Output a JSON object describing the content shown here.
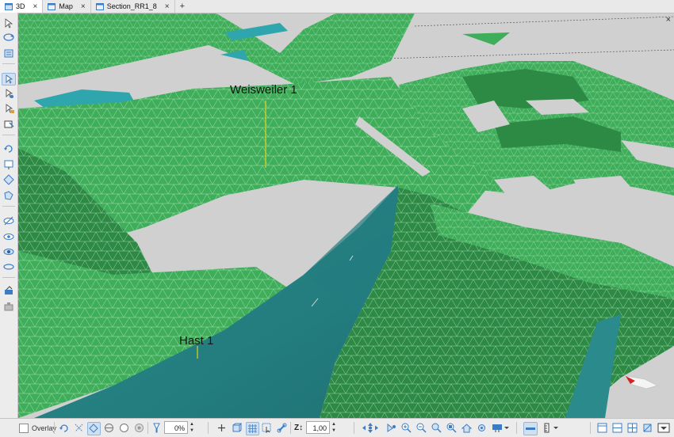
{
  "tabs": [
    {
      "label": "3D",
      "icon": "3d-window-icon",
      "active": true
    },
    {
      "label": "Map",
      "icon": "map-window-icon",
      "active": false
    },
    {
      "label": "Section_RR1_8",
      "icon": "section-window-icon",
      "active": false
    }
  ],
  "tabs_add": "+",
  "viewport": {
    "close": "×",
    "wells": [
      {
        "name": "Weisweiler 1"
      },
      {
        "name": "Hast 1"
      }
    ],
    "colors": {
      "surface_green": "#3fae5a",
      "surface_dark": "#2d8a45",
      "teal_surface": "#2a8a8c",
      "background": "#d0d0d0",
      "well_trajectory": "#e1d21e"
    }
  },
  "bottombar": {
    "overlay_label": "Overlay",
    "transparency_value": "0%",
    "zscale_label": "Z↕",
    "zscale_value": "1,00"
  },
  "icons": {
    "left_toolbar": [
      "select-arrow-icon",
      "rotate-view-icon",
      "layers-icon",
      "pick-mode-icon",
      "select-node-icon",
      "measure-icon",
      "edit-point-icon",
      "orbit-icon",
      "frame-icon",
      "fit-view-icon",
      "polygon-icon",
      "hide-icon",
      "show-icon",
      "eye-icon",
      "ellipse-icon",
      "paint-icon",
      "stamp-icon"
    ],
    "bottom_toolbar": [
      "rotate-icon",
      "pan-icon",
      "light-icon",
      "globe-icon",
      "circle-icon",
      "record-icon",
      "transparency-icon",
      "add-icon",
      "box-icon",
      "grid-icon",
      "cursor-icon",
      "link-icon",
      "zscale-icon",
      "nav-arrows-icon",
      "camera-icon",
      "zoom-in-icon",
      "zoom-out-icon",
      "zoom-fit-icon",
      "home-icon",
      "settings-icon",
      "save-view-icon",
      "screenshot-icon",
      "ruler-icon",
      "clip-icon",
      "layout-single-icon",
      "layout-split-icon",
      "layout-grid-icon",
      "more-icon"
    ]
  }
}
